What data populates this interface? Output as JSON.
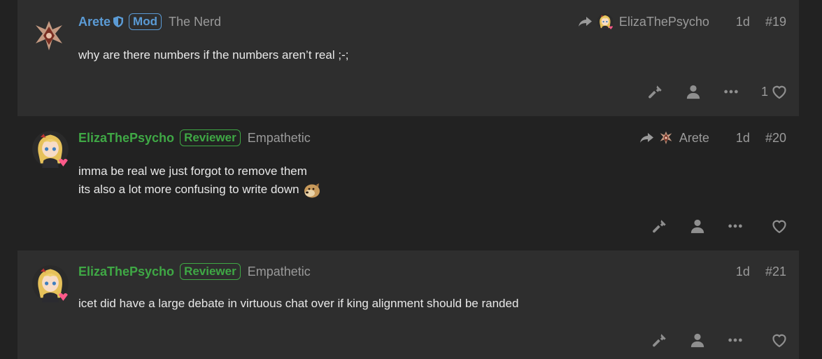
{
  "posts": [
    {
      "username": "Arete",
      "flair": "Mod",
      "user_title": "The Nerd",
      "reply_to": "ElizaThePsycho",
      "age": "1d",
      "number": "#19",
      "lines": [
        "why are there numbers if the numbers aren’t real ;-;"
      ],
      "like_count": "1"
    },
    {
      "username": "ElizaThePsycho",
      "flair": "Reviewer",
      "user_title": "Empathetic",
      "reply_to": "Arete",
      "age": "1d",
      "number": "#20",
      "lines": [
        "imma be real we just forgot to remove them",
        "its also a lot more confusing to write down"
      ],
      "like_count": ""
    },
    {
      "username": "ElizaThePsycho",
      "flair": "Reviewer",
      "user_title": "Empathetic",
      "age": "1d",
      "number": "#21",
      "lines": [
        "icet did have a large debate in virtuous chat over if king alignment should be randed"
      ],
      "like_count": ""
    }
  ],
  "colors": {
    "mod": "#5b9bd5",
    "reviewer": "#3fa845",
    "muted": "#9a9a9a",
    "post_bg_alt": "#2e2e2e",
    "page_bg": "#222222"
  },
  "icons": [
    "shield-icon",
    "reply-arrow-icon",
    "hammer-icon",
    "user-icon",
    "more-icon",
    "heart-icon",
    "doge-emoji"
  ]
}
